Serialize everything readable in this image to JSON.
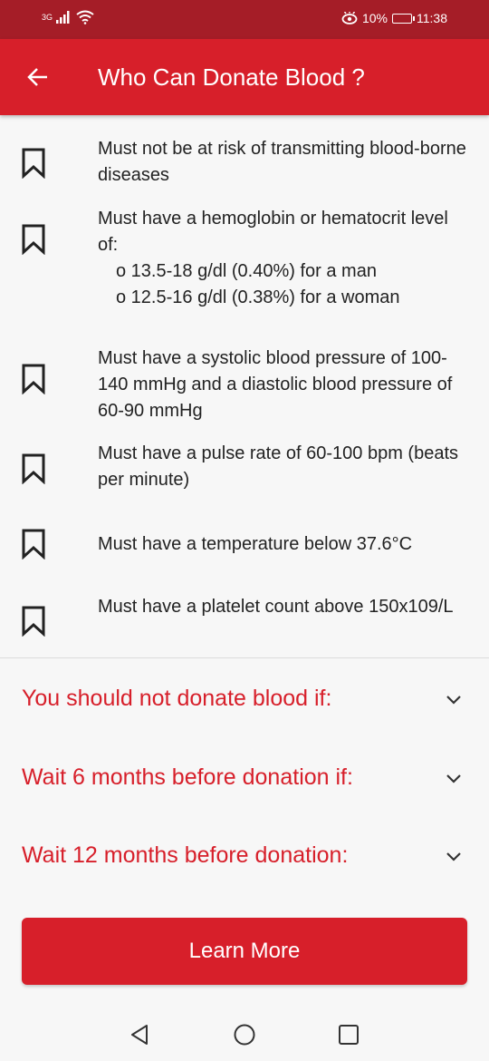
{
  "status_bar": {
    "network": "3G",
    "battery_percent": "10%",
    "time": "11:38"
  },
  "app_bar": {
    "title": "Who Can Donate Blood ?",
    "back_icon": "arrow-left-icon"
  },
  "requirements": [
    {
      "text": "Must not be at risk of transmitting blood-borne diseases"
    },
    {
      "text": "Must have a hemoglobin or hematocrit level of:",
      "sub": [
        "o 13.5-18 g/dl (0.40%) for a man",
        "o 12.5-16 g/dl (0.38%) for a woman"
      ]
    },
    {
      "text": "Must have a systolic blood pressure of 100-140 mmHg and a diastolic blood pressure of 60-90 mmHg"
    },
    {
      "text": "Must have a pulse rate of 60-100 bpm (beats per minute)"
    },
    {
      "text": "Must have a temperature below 37.6°C"
    },
    {
      "text": "Must have a platelet count above 150x109/L"
    }
  ],
  "sections": [
    {
      "label": "You should not donate blood if:"
    },
    {
      "label": "Wait 6 months before donation if:"
    },
    {
      "label": "Wait 12 months before donation:"
    }
  ],
  "learn_more_label": "Learn More",
  "colors": {
    "primary": "#d71f2a",
    "status_bar": "#a51d27",
    "background": "#f7f7f7"
  }
}
